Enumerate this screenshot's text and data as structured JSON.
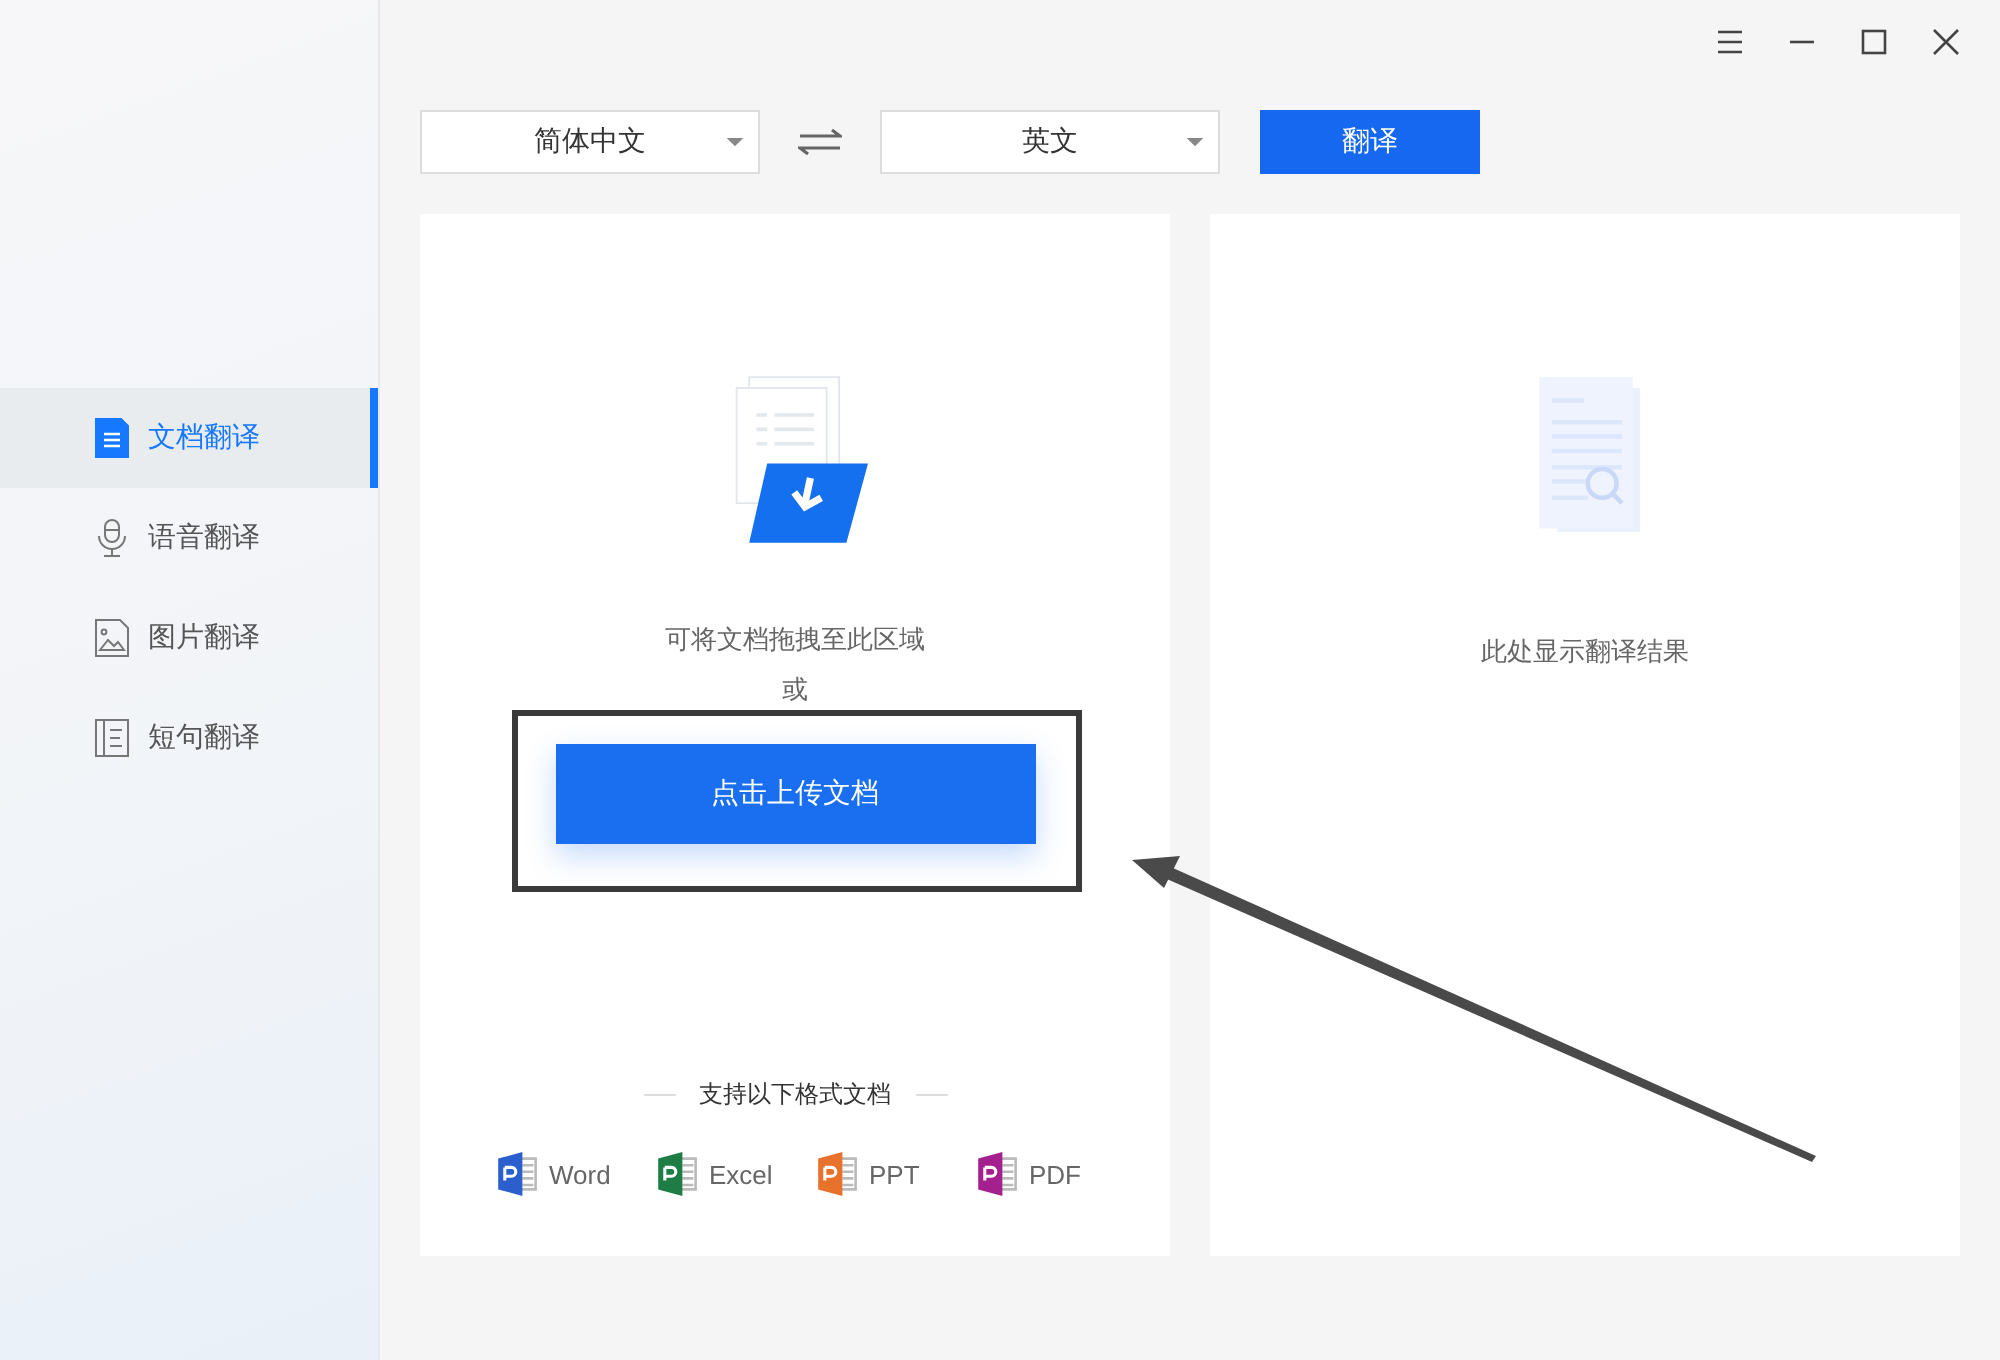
{
  "sidebar": {
    "items": [
      {
        "label": "文档翻译",
        "kind": "document",
        "selected": true
      },
      {
        "label": "语音翻译",
        "kind": "voice",
        "selected": false
      },
      {
        "label": "图片翻译",
        "kind": "image",
        "selected": false
      },
      {
        "label": "短句翻译",
        "kind": "sentence",
        "selected": false
      }
    ]
  },
  "toolbar": {
    "source_language": "简体中文",
    "target_language": "英文",
    "translate_button": "翻译"
  },
  "upload_panel": {
    "hint": "可将文档拖拽至此区域",
    "or": "或",
    "upload_button": "点击上传文档",
    "formats_title": "支持以下格式文档",
    "formats": [
      {
        "label": "Word",
        "color": "#2b5fce"
      },
      {
        "label": "Excel",
        "color": "#1e7d45"
      },
      {
        "label": "PPT",
        "color": "#e8712b"
      },
      {
        "label": "PDF",
        "color": "#a5208f"
      }
    ]
  },
  "result_panel": {
    "hint": "此处显示翻译结果"
  }
}
